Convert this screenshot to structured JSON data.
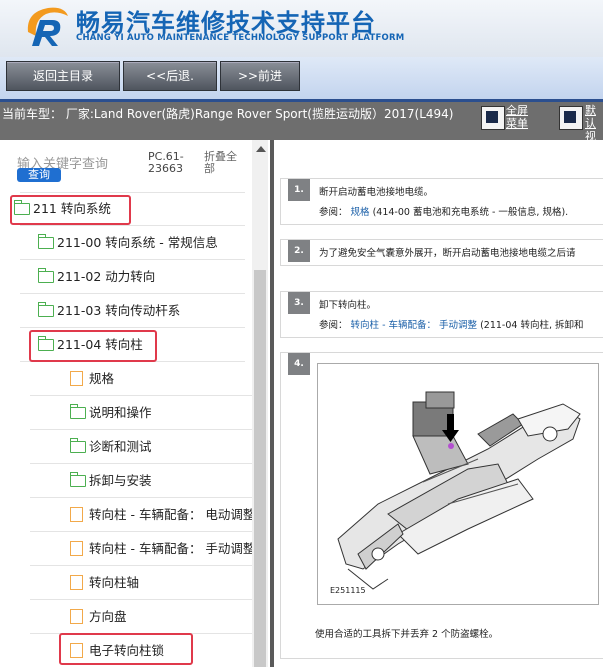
{
  "header": {
    "title": "畅易汽车维修技术支持平台",
    "subtitle": "CHANG YI AUTO MAINTENANCE TECHNOLOGY SUPPORT PLATFORM"
  },
  "nav": {
    "home": "返回主目录",
    "back": "<<后退.",
    "forward": ">>前进"
  },
  "car": {
    "info": "当前车型： 厂家:Land Rover(路虎)Range Rover Sport(揽胜运动版）2017(L494)",
    "fullscreen_line1": "全屏",
    "fullscreen_line2": "菜单",
    "default_line1": "默认",
    "default_line2": "视图"
  },
  "left": {
    "search_placeholder": "输入关键字查询",
    "query_button": "查询",
    "pc_code": "PC.61-23663",
    "collapse_all": "折叠全部",
    "tree": [
      {
        "label": "211 转向系统",
        "type": "folder"
      },
      {
        "label": "211-00 转向系统 - 常规信息",
        "type": "folder"
      },
      {
        "label": "211-02 动力转向",
        "type": "folder"
      },
      {
        "label": "211-03 转向传动杆系",
        "type": "folder"
      },
      {
        "label": "211-04 转向柱",
        "type": "folder"
      },
      {
        "label": "规格",
        "type": "doc"
      },
      {
        "label": "说明和操作",
        "type": "folder"
      },
      {
        "label": "诊断和测试",
        "type": "folder"
      },
      {
        "label": "拆卸与安装",
        "type": "folder"
      },
      {
        "label": "转向柱 - 车辆配备： 电动调整",
        "type": "doc"
      },
      {
        "label": "转向柱 - 车辆配备： 手动调整",
        "type": "doc"
      },
      {
        "label": "转向柱轴",
        "type": "doc"
      },
      {
        "label": "方向盘",
        "type": "doc"
      },
      {
        "label": "电子转向柱锁",
        "type": "doc"
      }
    ]
  },
  "steps": [
    {
      "no": "1.",
      "text": "断开启动蓄电池接地电缆。",
      "ref_prefix": "参阅：",
      "ref_link": "规格",
      "ref_suffix": "(414-00 蓄电池和充电系统 - 一般信息, 规格)."
    },
    {
      "no": "2.",
      "text": "为了避免安全气囊意外展开，断开启动蓄电池接地电缆之后请"
    },
    {
      "no": "3.",
      "text": "卸下转向柱。",
      "ref_prefix": "参阅：",
      "ref_link": "转向柱 - 车辆配备： 手动调整",
      "ref_suffix": "(211-04 转向柱, 拆卸和"
    },
    {
      "no": "4.",
      "figure_code": "E251115",
      "text": "使用合适的工具拆下并丢弃 2 个防盗螺栓。"
    }
  ]
}
